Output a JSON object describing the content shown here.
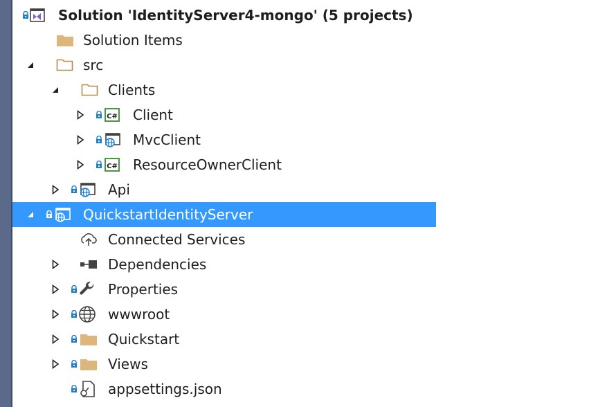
{
  "solution": {
    "label": "Solution 'IdentityServer4-mongo' (5 projects)"
  },
  "items": {
    "solution_items": "Solution Items",
    "src": "src",
    "clients": "Clients",
    "client": "Client",
    "mvcclient": "MvcClient",
    "resourceownerclient": "ResourceOwnerClient",
    "api": "Api",
    "quickstart_identity_server": "QuickstartIdentityServer",
    "connected_services": "Connected Services",
    "dependencies": "Dependencies",
    "properties": "Properties",
    "wwwroot": "wwwroot",
    "quickstart": "Quickstart",
    "views": "Views",
    "appsettings": "appsettings.json"
  },
  "icons": {
    "cs_badge": "C#"
  },
  "colors": {
    "selection": "#3399ff",
    "folder": "#dcb67a",
    "lock": "#1e7fd1",
    "csproj": "#388a34",
    "vs_purple": "#865fc5"
  }
}
